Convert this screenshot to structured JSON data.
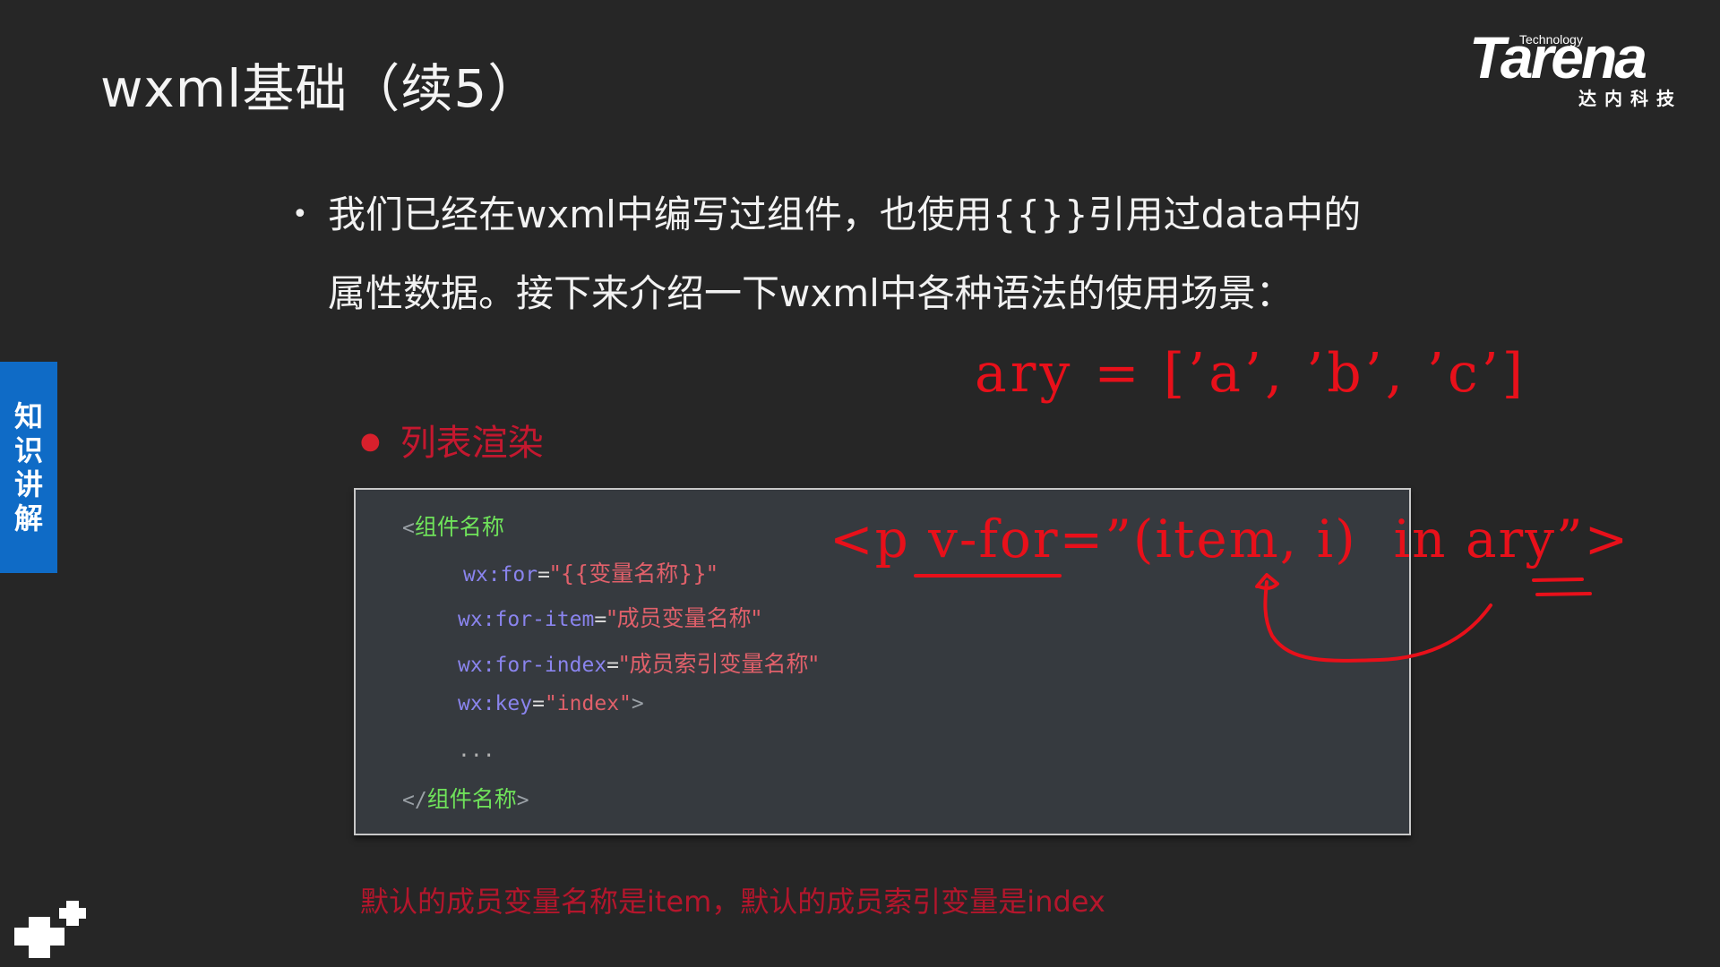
{
  "slide": {
    "title": "wxml基础（续5）",
    "logo": {
      "technology": "Technology",
      "brand": "Tarena",
      "cn": "达内科技"
    },
    "side_tab": [
      "知",
      "识",
      "讲",
      "解"
    ],
    "bullet_main": "我们已经在wxml中编写过组件，也使用{{}}引用过data中的属性数据。接下来介绍一下wxml中各种语法的使用场景：",
    "sub_bullet": "列表渲染",
    "code": {
      "open_tag_bracket": "<",
      "open_tag_name": "组件名称",
      "line_for_attr": "wx:for",
      "line_for_eq": "=",
      "line_for_value": "\"{{变量名称}}\"",
      "line_item_attr": "wx:for-item",
      "line_item_eq": "=",
      "line_item_value": "\"成员变量名称\"",
      "line_index_attr": "wx:for-index",
      "line_index_eq": "=",
      "line_index_value": "\"成员索引变量名称\"",
      "line_key_attr": "wx:key",
      "line_key_eq": "=",
      "line_key_value": "\"index\"",
      "line_key_close": ">",
      "ellipsis": "...",
      "close_tag_open": "</",
      "close_tag_name": "组件名称",
      "close_tag_end": ">"
    },
    "note": "默认的成员变量名称是item，默认的成员索引变量是index",
    "annotations": {
      "ary_line": "ary = [’a’, ’b’, ’c’]",
      "vfor_line": "<p v-for=”(item, i)  in ary”>",
      "ink_color": "#e8101a"
    },
    "colors": {
      "background": "#262626",
      "side_tab": "#0f6bc6",
      "code_bg": "#363a3f",
      "tag": "#6fe25a",
      "attr": "#8a84ee",
      "string": "#e0606a",
      "subtitle_red": "#c4182f"
    }
  }
}
